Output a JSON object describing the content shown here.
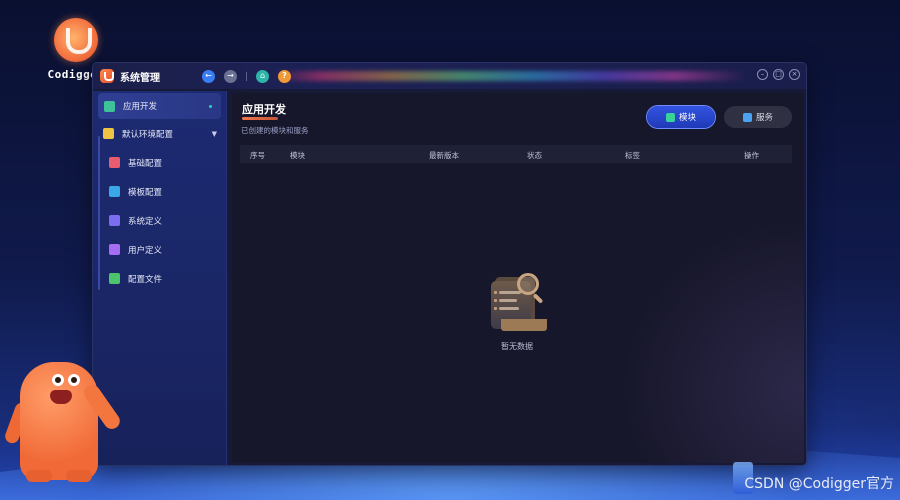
{
  "desktop": {
    "brand_name": "Codigger",
    "watermark": "CSDN @Codigger官方"
  },
  "window": {
    "title": "系统管理",
    "nav": {
      "back": "back-arrow-icon",
      "forward": "forward-arrow-icon",
      "home": "home-icon",
      "help": "?"
    },
    "controls": [
      "minimize-icon",
      "maximize-icon",
      "close-icon"
    ]
  },
  "sidebar": {
    "items": [
      {
        "label": "应用开发",
        "icon": "app-dev-icon",
        "active": true,
        "color": "#3ec29a"
      },
      {
        "label": "默认环境配置",
        "icon": "env-config-icon",
        "expanded": true,
        "color": "#f0c443"
      },
      {
        "label": "基础配置",
        "icon": "basic-config-icon",
        "color": "#e95b6e"
      },
      {
        "label": "模板配置",
        "icon": "template-config-icon",
        "color": "#3aa8e6"
      },
      {
        "label": "系统定义",
        "icon": "system-def-icon",
        "color": "#7c6cf0"
      },
      {
        "label": "用户定义",
        "icon": "user-def-icon",
        "color": "#a56ef2"
      },
      {
        "label": "配置文件",
        "icon": "config-file-icon",
        "color": "#4cc46b"
      }
    ]
  },
  "main": {
    "title": "应用开发",
    "subtitle": "已创建的模块和服务",
    "tabs": [
      {
        "label": "模块",
        "icon": "stack-icon",
        "active": true
      },
      {
        "label": "服务",
        "icon": "service-icon",
        "active": false
      }
    ],
    "table": {
      "columns": [
        "序号",
        "模块",
        "最新版本",
        "状态",
        "标签",
        "操作"
      ]
    },
    "empty_text": "暂无数据"
  },
  "colors": {
    "accent": "#2f4fdc",
    "title_underline": "#f3744a",
    "sidebar_bg": "#1c2a72",
    "panel_bg": "#17172b"
  }
}
